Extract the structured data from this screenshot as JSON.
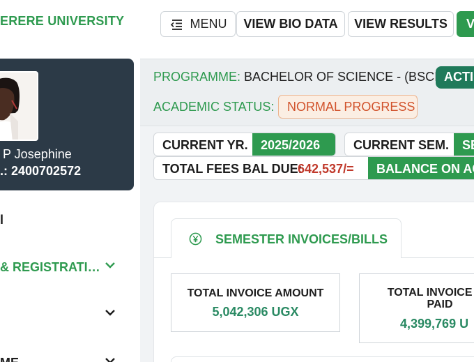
{
  "header": {
    "university": "ERERE UNIVERSITY",
    "menu_label": "MENU",
    "bio_label": "VIEW BIO DATA",
    "results_label": "VIEW RESULTS",
    "cut_button_label": "V"
  },
  "profile": {
    "name": "P Josephine",
    "reg_no": ".: 2400702572"
  },
  "sidebar": {
    "items": [
      {
        "label": "l"
      },
      {
        "label": "& REGISTRATI…"
      },
      {
        "label": ""
      },
      {
        "label": "ME"
      }
    ]
  },
  "info": {
    "programme_label": "PROGRAMME:",
    "programme_value": "BACHELOR OF SCIENCE - (BSCI)",
    "active_badge": "ACTI",
    "academic_label": "ACADEMIC STATUS:",
    "academic_value": "NORMAL PROGRESS"
  },
  "stats": {
    "current_year_label": "CURRENT YR.",
    "current_year_value": "2025/2026",
    "current_sem_label": "CURRENT SEM.",
    "current_sem_value": "SE",
    "fees_label": "TOTAL FEES BAL DUE:",
    "fees_value": "642,537/=",
    "balance_label": "BALANCE ON AC"
  },
  "invoices": {
    "tab_label": "SEMESTER INVOICES/BILLS",
    "total_invoice_label": "TOTAL INVOICE AMOUNT",
    "total_invoice_value": "5,042,306 UGX",
    "paid_label_line1": "TOTAL INVOICE AM",
    "paid_label_line2": "PAID",
    "paid_value": "4,399,769 U"
  },
  "colors": {
    "brand_green": "#2e9a4f",
    "sidebar_dark": "#2c3a47",
    "fees_red": "#c0392b",
    "badge_teal": "#1f7a5a"
  }
}
